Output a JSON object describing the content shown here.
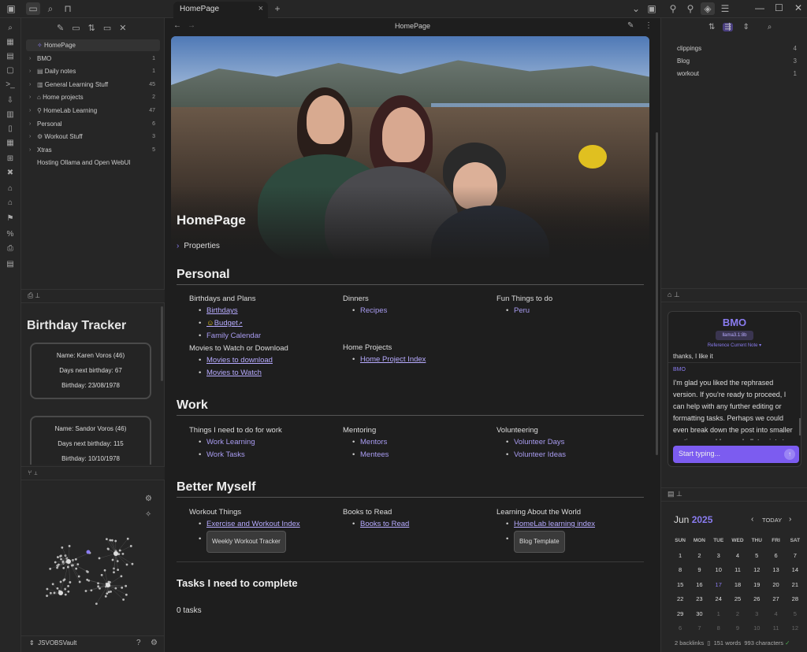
{
  "tab": {
    "title": "HomePage"
  },
  "nav": {
    "title": "HomePage"
  },
  "tree": {
    "items": [
      {
        "label": "HomePage",
        "count": ""
      },
      {
        "label": "BMO",
        "count": "1"
      },
      {
        "label": "Daily notes",
        "count": "1"
      },
      {
        "label": "General Learning Stuff",
        "count": "45"
      },
      {
        "label": "Home projects",
        "count": "2"
      },
      {
        "label": "HomeLab Learning",
        "count": "47"
      },
      {
        "label": "Personal",
        "count": "6"
      },
      {
        "label": "Workout Stuff",
        "count": "3"
      },
      {
        "label": "Xtras",
        "count": "5"
      },
      {
        "label": "Hosting Ollama and Open WebUI",
        "count": ""
      }
    ]
  },
  "birthday": {
    "title": "Birthday Tracker",
    "cards": [
      {
        "name": "Name: Karen Voros (46)",
        "next": "Days next birthday: 67",
        "dob": "Birthday: 23/08/1978"
      },
      {
        "name": "Name: Sandor Voros (46)",
        "next": "Days next birthday: 115",
        "dob": "Birthday: 10/10/1978"
      }
    ]
  },
  "vault": {
    "name": "JSVOBSVault"
  },
  "note": {
    "title": "HomePage",
    "properties": "Properties",
    "personal": {
      "heading": "Personal",
      "c1": {
        "h1": "Birthdays and Plans",
        "l1": "Birthdays",
        "l2": "Budget",
        "l3": "Family Calendar",
        "h2": "Movies to Watch or Download",
        "l4": "Movies to download",
        "l5": "Movies to Watch"
      },
      "c2": {
        "h1": "Dinners",
        "l1": "Recipes",
        "h2": "Home Projects",
        "l2": "Home Project Index"
      },
      "c3": {
        "h1": "Fun Things to do",
        "l1": "Peru"
      }
    },
    "work": {
      "heading": "Work",
      "c1": {
        "h": "Things I need to do for work",
        "l1": "Work Learning",
        "l2": "Work Tasks"
      },
      "c2": {
        "h": "Mentoring",
        "l1": "Mentors",
        "l2": "Mentees"
      },
      "c3": {
        "h": "Volunteering",
        "l1": "Volunteer Days",
        "l2": "Volunteer Ideas"
      }
    },
    "better": {
      "heading": "Better Myself",
      "c1": {
        "h": "Workout Things",
        "l1": "Exercise and Workout Index",
        "b1": "Weekly Workout Tracker"
      },
      "c2": {
        "h": "Books to Read",
        "l1": "Books to Read"
      },
      "c3": {
        "h": "Learning About the World",
        "l1": "HomeLab learning index",
        "b1": "Blog Template"
      }
    },
    "tasks": {
      "heading": "Tasks I need to complete",
      "count": "0 tasks"
    }
  },
  "tags": [
    {
      "name": "clippings",
      "count": "4"
    },
    {
      "name": "Blog",
      "count": "3"
    },
    {
      "name": "workout",
      "count": "1"
    }
  ],
  "chat": {
    "name": "BMO",
    "version": "llama3.1:8b",
    "ref": "Reference Current Note",
    "prev": "thanks, I like it",
    "sender": "BMO",
    "message": "I'm glad you liked the rephrased version. If you're ready to proceed, I can help with any further editing or formatting tasks. Perhaps we could even break down the post into smaller sections or add some bullet points to",
    "placeholder": "Start typing..."
  },
  "calendar": {
    "month": "Jun",
    "year": "2025",
    "today_label": "TODAY",
    "days": [
      "SUN",
      "MON",
      "TUE",
      "WED",
      "THU",
      "FRI",
      "SAT"
    ],
    "weeks": [
      [
        "1",
        "2",
        "3",
        "4",
        "5",
        "6",
        "7"
      ],
      [
        "8",
        "9",
        "10",
        "11",
        "12",
        "13",
        "14"
      ],
      [
        "15",
        "16",
        "17",
        "18",
        "19",
        "20",
        "21"
      ],
      [
        "22",
        "23",
        "24",
        "25",
        "26",
        "27",
        "28"
      ],
      [
        "29",
        "30",
        "1",
        "2",
        "3",
        "4",
        "5"
      ],
      [
        "6",
        "7",
        "8",
        "9",
        "10",
        "11",
        "12"
      ]
    ]
  },
  "status": {
    "backlinks": "2 backlinks",
    "words": "151 words",
    "chars": "993 characters"
  }
}
